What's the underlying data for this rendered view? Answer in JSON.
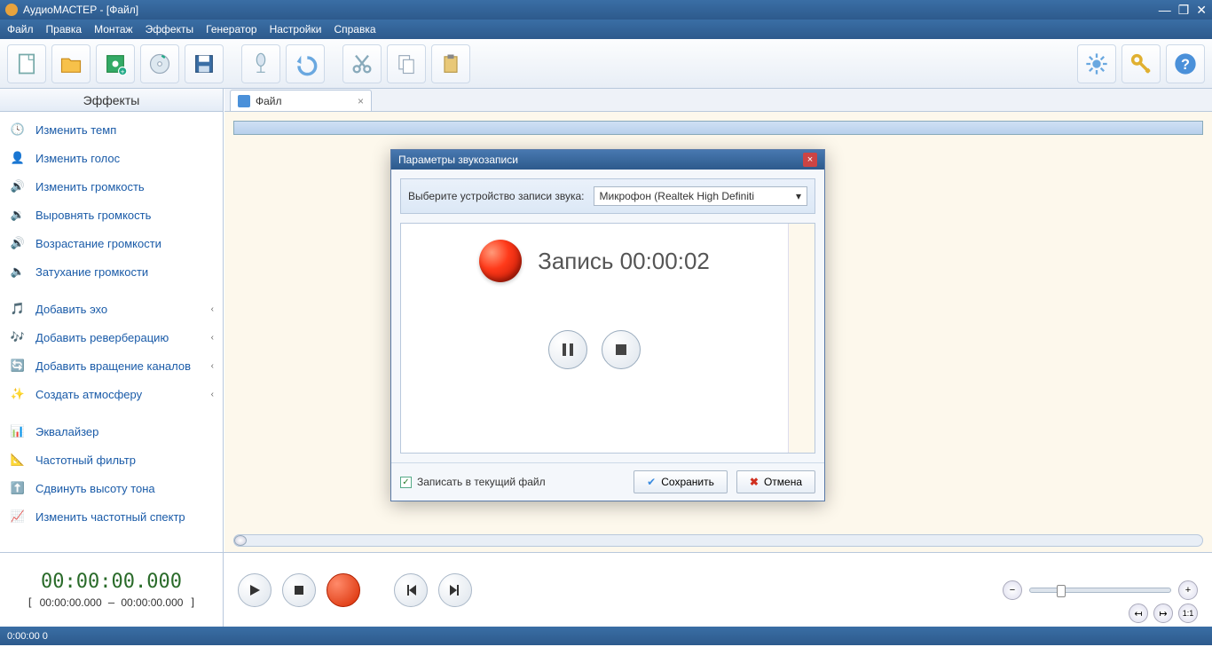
{
  "window": {
    "title": "АудиоМАСТЕР - [Файл]"
  },
  "menu": [
    "Файл",
    "Правка",
    "Монтаж",
    "Эффекты",
    "Генератор",
    "Настройки",
    "Справка"
  ],
  "toolbar": {
    "new": "new",
    "open": "open",
    "video": "video",
    "cd": "cd",
    "save": "save",
    "mic": "mic",
    "undo": "undo",
    "cut": "cut",
    "copy": "copy",
    "paste": "paste",
    "settings": "settings",
    "key": "key",
    "help": "help"
  },
  "sidebar": {
    "title": "Эффекты",
    "items": [
      {
        "label": "Изменить темп",
        "icon": "clock"
      },
      {
        "label": "Изменить голос",
        "icon": "person"
      },
      {
        "label": "Изменить громкость",
        "icon": "speaker"
      },
      {
        "label": "Выровнять громкость",
        "icon": "speaker-eq"
      },
      {
        "label": "Возрастание громкости",
        "icon": "vol-up"
      },
      {
        "label": "Затухание громкости",
        "icon": "vol-down"
      }
    ],
    "items2": [
      {
        "label": "Добавить эхо",
        "icon": "echo",
        "sub": true
      },
      {
        "label": "Добавить реверберацию",
        "icon": "reverb",
        "sub": true
      },
      {
        "label": "Добавить вращение каналов",
        "icon": "rotate",
        "sub": true
      },
      {
        "label": "Создать атмосферу",
        "icon": "atmo",
        "sub": true
      }
    ],
    "items3": [
      {
        "label": "Эквалайзер",
        "icon": "eq"
      },
      {
        "label": "Частотный фильтр",
        "icon": "filter"
      },
      {
        "label": "Сдвинуть высоту тона",
        "icon": "pitch"
      },
      {
        "label": "Изменить частотный спектр",
        "icon": "spectrum"
      }
    ]
  },
  "tab": {
    "label": "Файл"
  },
  "time": {
    "big": "00:00:00.000",
    "from": "00:00:00.000",
    "to": "00:00:00.000"
  },
  "status": "0:00:00 0",
  "dialog": {
    "title": "Параметры звукозаписи",
    "device_label": "Выберите устройство записи звука:",
    "device_value": "Микрофон (Realtek High Definiti",
    "rec_label": "Запись",
    "rec_time": "00:00:02",
    "check_label": "Записать в текущий файл",
    "save": "Сохранить",
    "cancel": "Отмена"
  }
}
